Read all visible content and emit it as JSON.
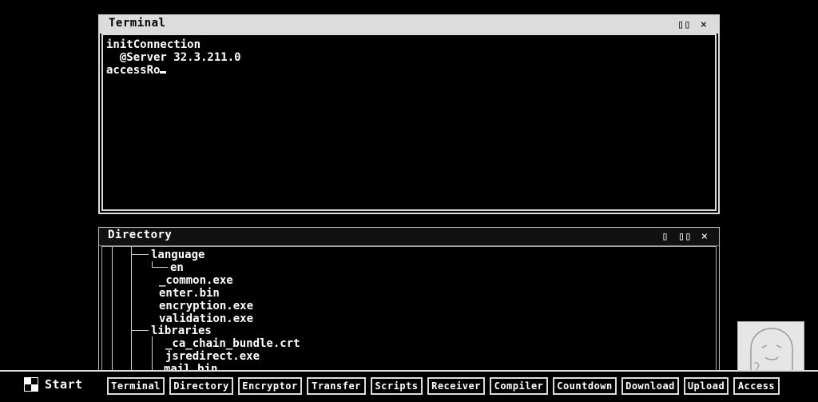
{
  "terminal": {
    "title": "Terminal",
    "lines": [
      "initConnection",
      "  @Server 32.3.211.0",
      "accessRo"
    ]
  },
  "directory": {
    "title": "Directory",
    "items": [
      "language",
      "en",
      "_common.exe",
      "enter.bin",
      "encryption.exe",
      "validation.exe",
      "libraries",
      "_ca_chain_bundle.crt",
      "jsredirect.exe",
      "mail.bin"
    ]
  },
  "window_controls": {
    "minimize_glyph": "▯",
    "maximize_glyph": "▯▯",
    "close_glyph": "×"
  },
  "taskbar": {
    "start_label": "Start",
    "buttons": [
      "Terminal",
      "Directory",
      "Encryptor",
      "Transfer",
      "Scripts",
      "Receiver",
      "Compiler",
      "Countdown",
      "Download",
      "Upload",
      "Access"
    ]
  },
  "icons": {
    "start": "start-logo-icon",
    "ghost": "ghost-icon"
  },
  "colors": {
    "background": "#000000",
    "chrome": "#dcdcdc",
    "text": "#ffffff",
    "ghost_bg": "#e6e6e6"
  }
}
